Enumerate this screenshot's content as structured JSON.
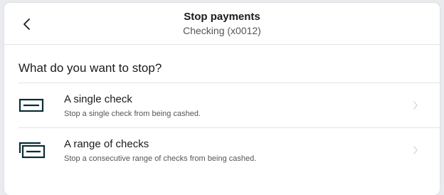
{
  "header": {
    "title": "Stop payments",
    "subtitle": "Checking (x0012)",
    "back_icon": "chevron-left-icon"
  },
  "question": "What do you want to stop?",
  "options": [
    {
      "title": "A single check",
      "description": "Stop a single check from being cashed.",
      "icon": "single-check-icon"
    },
    {
      "title": "A range of checks",
      "description": "Stop a consecutive range of checks from being cashed.",
      "icon": "multiple-checks-icon"
    }
  ],
  "colors": {
    "background": "#e9ebee",
    "card": "#ffffff",
    "icon": "#0b2c36",
    "divider": "#e3e3e3",
    "chevron": "#d6d6d6"
  }
}
